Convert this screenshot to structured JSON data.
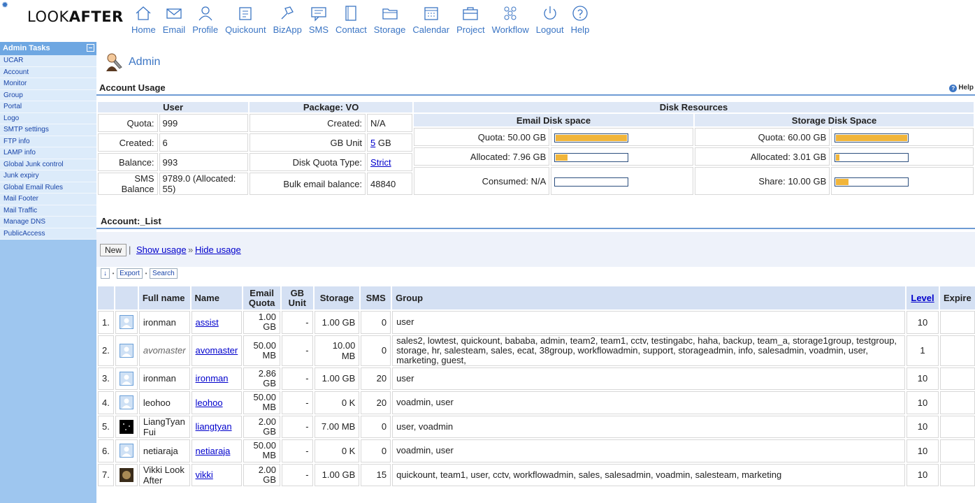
{
  "app": {
    "logo_light": "LOOK",
    "logo_bold": "AFTER"
  },
  "nav": [
    {
      "label": "Home",
      "icon": "home-icon"
    },
    {
      "label": "Email",
      "icon": "email-icon"
    },
    {
      "label": "Profile",
      "icon": "profile-icon"
    },
    {
      "label": "Quickount",
      "icon": "quickount-icon"
    },
    {
      "label": "BizApp",
      "icon": "bizapp-icon"
    },
    {
      "label": "SMS",
      "icon": "sms-icon"
    },
    {
      "label": "Contact",
      "icon": "contact-icon"
    },
    {
      "label": "Storage",
      "icon": "storage-icon"
    },
    {
      "label": "Calendar",
      "icon": "calendar-icon"
    },
    {
      "label": "Project",
      "icon": "project-icon"
    },
    {
      "label": "Workflow",
      "icon": "workflow-icon"
    },
    {
      "label": "Logout",
      "icon": "logout-icon"
    },
    {
      "label": "Help",
      "icon": "help-icon"
    }
  ],
  "sidebar": {
    "title": "Admin Tasks",
    "items": [
      "UCAR",
      "Account",
      "Monitor",
      "Group",
      "Portal",
      "Logo",
      "SMTP settings",
      "FTP info",
      "LAMP info",
      "Global Junk control",
      "Junk expiry",
      "Global Email Rules",
      "Mail Footer",
      "Mail Traffic",
      "Manage DNS",
      "PublicAccess"
    ]
  },
  "page": {
    "title": "Admin"
  },
  "usage": {
    "title": "Account Usage",
    "help": "Help",
    "user_header": "User",
    "package_header": "Package: VO",
    "disk_header": "Disk Resources",
    "email_disk_header": "Email Disk space",
    "storage_disk_header": "Storage Disk Space",
    "user": {
      "quota_label": "Quota:",
      "quota": "999",
      "created_label": "Created:",
      "created": "6",
      "balance_label": "Balance:",
      "balance": "993",
      "sms_label": "SMS Balance",
      "sms": "9789.0 (Allocated: 55)"
    },
    "package": {
      "created_label": "Created:",
      "created": "N/A",
      "gbunit_label": "GB Unit",
      "gbunit_value": "5",
      "gbunit_unit": " GB",
      "quota_type_label": "Disk Quota Type:",
      "quota_type": "Strict",
      "bulk_label": "Bulk email balance:",
      "bulk": "48840"
    },
    "email_disk": {
      "quota": "Quota: 50.00 GB",
      "quota_fill": 1.0,
      "allocated": "Allocated: 7.96 GB",
      "allocated_fill": 0.16,
      "consumed": "Consumed: N/A",
      "consumed_fill": 0
    },
    "storage_disk": {
      "quota": "Quota: 60.00 GB",
      "quota_fill": 1.0,
      "allocated": "Allocated: 3.01 GB",
      "allocated_fill": 0.05,
      "share": "Share: 10.00 GB",
      "share_fill": 0.17
    }
  },
  "list": {
    "title": "Account:_List",
    "new_label": "New",
    "sep": "|",
    "show_usage": "Show usage",
    "arrow": "»",
    "hide_usage": "Hide usage",
    "sort_label": "↓",
    "export_label": "Export",
    "search_label": "Search",
    "dot": "•",
    "headers": {
      "full": "Full name",
      "name": "Name",
      "email_quota": "Email Quota",
      "gb_unit": "GB Unit",
      "storage": "Storage",
      "sms": "SMS",
      "group": "Group",
      "level": "Level",
      "expire": "Expire"
    },
    "rows": [
      {
        "num": "1.",
        "full": "ironman",
        "name": "assist",
        "email": "1.00 GB",
        "gb": "-",
        "storage": "1.00 GB",
        "sms": "0",
        "group": "user",
        "level": "10",
        "avatar": "default"
      },
      {
        "num": "2.",
        "full": "avomaster",
        "name": "avomaster",
        "email": "50.00 MB",
        "gb": "-",
        "storage": "10.00 MB",
        "sms": "0",
        "group": "sales2, lowtest, quickount, bababa, admin, team2, team1, cctv, testingabc, haha, backup, team_a, storage1group, testgroup, storage, hr, salesteam, sales, ecat, 38group, workflowadmin, support, storageadmin, info, salesadmin, voadmin, user, marketing, guest,",
        "level": "1",
        "avatar": "default"
      },
      {
        "num": "3.",
        "full": "ironman",
        "name": "ironman",
        "email": "2.86 GB",
        "gb": "-",
        "storage": "1.00 GB",
        "sms": "20",
        "group": "user",
        "level": "10",
        "avatar": "default"
      },
      {
        "num": "4.",
        "full": "leohoo",
        "name": "leohoo",
        "email": "50.00 MB",
        "gb": "-",
        "storage": "0 K",
        "sms": "20",
        "group": "voadmin, user",
        "level": "10",
        "avatar": "default"
      },
      {
        "num": "5.",
        "full": "LiangTyan Fui",
        "name": "liangtyan",
        "email": "2.00 GB",
        "gb": "-",
        "storage": "7.00 MB",
        "sms": "0",
        "group": "user, voadmin",
        "level": "10",
        "avatar": "dark"
      },
      {
        "num": "6.",
        "full": "netiaraja",
        "name": "netiaraja",
        "email": "50.00 MB",
        "gb": "-",
        "storage": "0 K",
        "sms": "0",
        "group": "voadmin, user",
        "level": "10",
        "avatar": "default"
      },
      {
        "num": "7.",
        "full": "Vikki Look After",
        "name": "vikki",
        "email": "2.00 GB",
        "gb": "-",
        "storage": "1.00 GB",
        "sms": "15",
        "group": "quickount, team1, user, cctv, workflowadmin, sales, salesadmin, voadmin, salesteam, marketing",
        "level": "10",
        "avatar": "photo"
      }
    ]
  },
  "colors": {
    "accent": "#3b75c4",
    "sidebar": "#9ec6ef",
    "bar_fill": "#f1b53a"
  }
}
